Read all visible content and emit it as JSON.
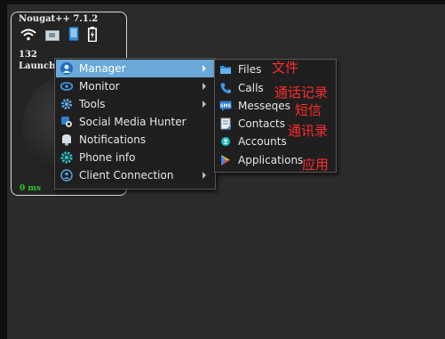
{
  "device": {
    "title": "Nougat++ 7.1.2",
    "count": "132",
    "label": "Launche",
    "latency": "0 ms",
    "status_icons": [
      "wifi-icon",
      "sim-card-icon",
      "phone-icon",
      "battery-icon"
    ]
  },
  "menu": {
    "items": [
      {
        "label": "Manager",
        "icon": "manager-icon",
        "has_submenu": true,
        "active": true
      },
      {
        "label": "Monitor",
        "icon": "eye-icon",
        "has_submenu": true
      },
      {
        "label": "Tools",
        "icon": "tools-gear-icon",
        "has_submenu": true
      },
      {
        "label": "Social Media Hunter",
        "icon": "social-hunter-icon",
        "has_submenu": false
      },
      {
        "label": "Notifications",
        "icon": "notification-icon",
        "has_submenu": false
      },
      {
        "label": "Phone info",
        "icon": "phone-info-gear-icon",
        "has_submenu": false
      },
      {
        "label": "Client Connection",
        "icon": "client-connection-icon",
        "has_submenu": true
      }
    ]
  },
  "submenu": {
    "items": [
      {
        "label": "Files",
        "icon": "files-folder-icon"
      },
      {
        "label": "Calls",
        "icon": "phone-call-icon"
      },
      {
        "label": "Messeqes",
        "icon": "sms-icon"
      },
      {
        "label": "Contacts",
        "icon": "contacts-icon"
      },
      {
        "label": "Accounts",
        "icon": "accounts-icon"
      },
      {
        "label": "Applications",
        "icon": "play-store-icon"
      }
    ]
  },
  "annotations": [
    "文件",
    "通话记录",
    "短信",
    "通讯录",
    "应用"
  ],
  "colors": {
    "highlight": "#6aa8d8",
    "annotation": "#ff2a2a",
    "latency": "#22cc22"
  }
}
